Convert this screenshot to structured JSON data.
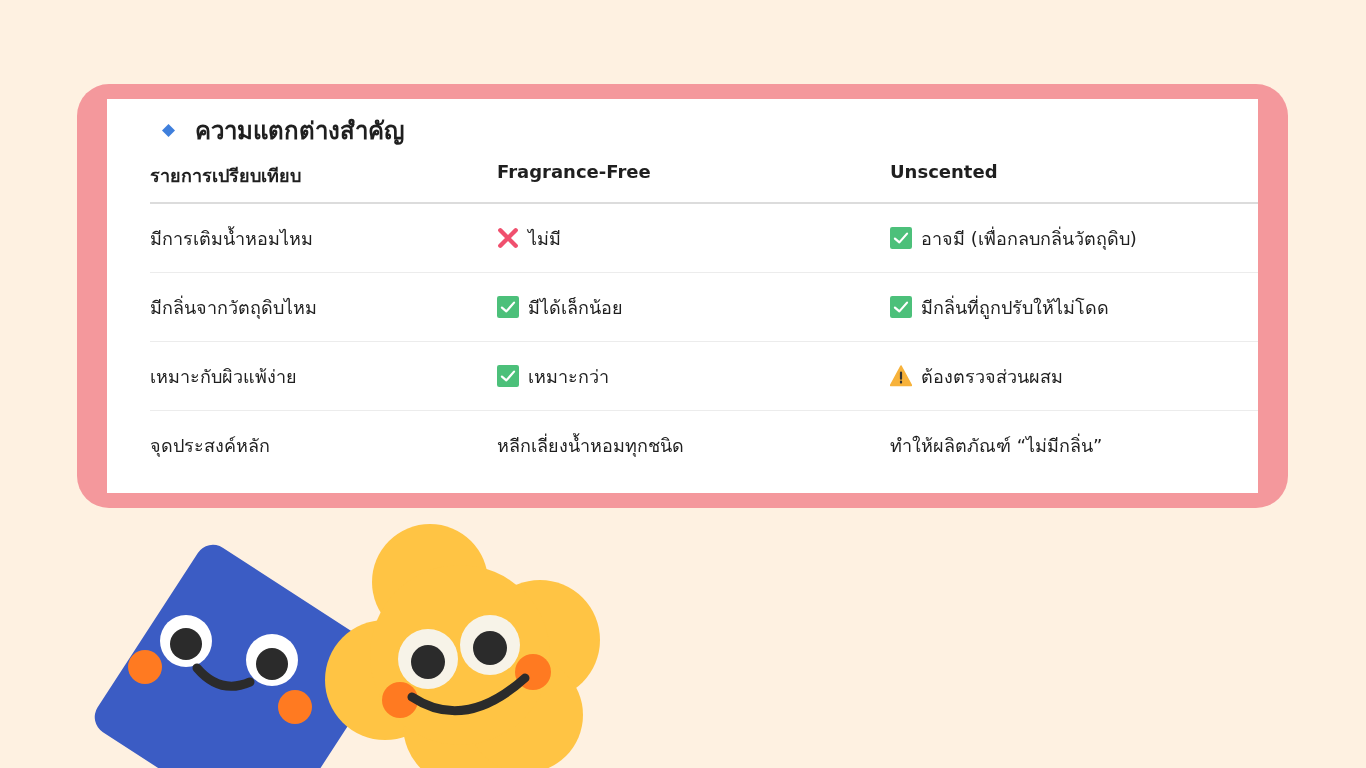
{
  "section": {
    "title": "ความแตกต่างสำคัญ"
  },
  "table": {
    "columns": [
      "รายการเปรียบเทียบ",
      "Fragrance-Free",
      "Unscented"
    ],
    "rows": [
      {
        "cells": [
          {
            "kind": "plain",
            "text": "มีการเติมน้ำหอมไหม"
          },
          {
            "kind": "cross",
            "text": "ไม่มี"
          },
          {
            "kind": "check",
            "text": "อาจมี (เพื่อกลบกลิ่นวัตถุดิบ)"
          }
        ]
      },
      {
        "cells": [
          {
            "kind": "plain",
            "text": "มีกลิ่นจากวัตถุดิบไหม"
          },
          {
            "kind": "check",
            "text": "มีได้เล็กน้อย"
          },
          {
            "kind": "check",
            "text": "มีกลิ่นที่ถูกปรับให้ไม่โดด"
          }
        ]
      },
      {
        "cells": [
          {
            "kind": "plain",
            "text": "เหมาะกับผิวแพ้ง่าย"
          },
          {
            "kind": "check",
            "text": "เหมาะกว่า"
          },
          {
            "kind": "warning",
            "text": "ต้องตรวจส่วนผสม"
          }
        ]
      },
      {
        "cells": [
          {
            "kind": "plain",
            "text": "จุดประสงค์หลัก"
          },
          {
            "kind": "plain",
            "text": "หลีกเลี่ยงน้ำหอมทุกชนิด"
          },
          {
            "kind": "plain",
            "text": "ทำให้ผลิตภัณฑ์ “ไม่มีกลิ่น”"
          }
        ]
      }
    ]
  }
}
